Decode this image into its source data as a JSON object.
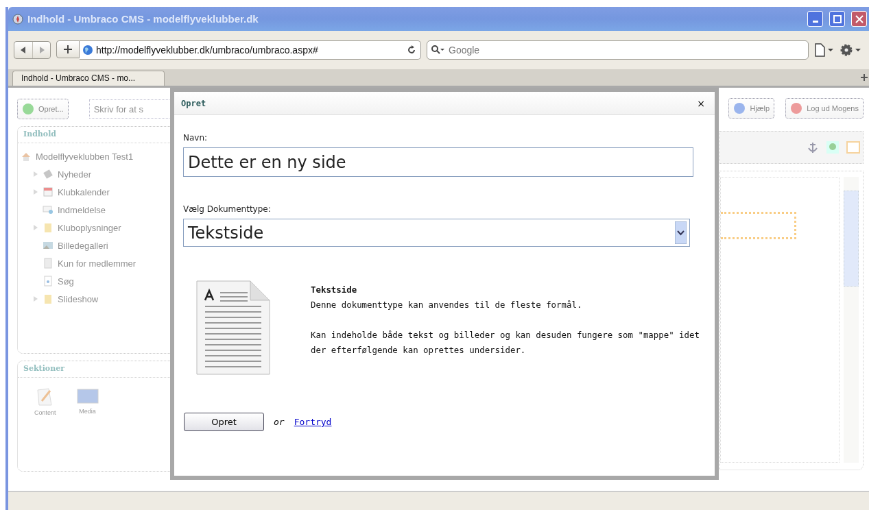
{
  "browser": {
    "title": "Indhold - Umbraco CMS - modelflyveklubber.dk",
    "url": "http://modelflyveklubber.dk/umbraco/umbraco.aspx#",
    "search_placeholder": "Google",
    "tab_label": "Indhold - Umbraco CMS - mo..."
  },
  "toolbar": {
    "create_button": "Opret...",
    "search_placeholder": "Skriv for at s",
    "help_button": "Hjælp",
    "logout_button": "Log ud Mogens"
  },
  "content_panel": {
    "title": "Indhold",
    "tree": [
      {
        "label": "Modelflyveklubben Test1",
        "kind": "home",
        "children": [
          {
            "label": "Nyheder",
            "kind": "news",
            "has_children": true
          },
          {
            "label": "Klubkalender",
            "kind": "calendar",
            "has_children": true
          },
          {
            "label": "Indmeldelse",
            "kind": "form",
            "has_children": false
          },
          {
            "label": "Kluboplysninger",
            "kind": "folder",
            "has_children": true
          },
          {
            "label": "Billedegalleri",
            "kind": "gallery",
            "has_children": false
          },
          {
            "label": "Kun for medlemmer",
            "kind": "page",
            "has_children": false
          },
          {
            "label": "Søg",
            "kind": "search",
            "has_children": false
          },
          {
            "label": "Slideshow",
            "kind": "folder",
            "has_children": true
          }
        ]
      }
    ]
  },
  "sections_panel": {
    "title": "Sektioner",
    "items": [
      {
        "label": "Content",
        "kind": "content"
      },
      {
        "label": "Media",
        "kind": "media"
      }
    ]
  },
  "dialog": {
    "title": "Opret",
    "close": "×",
    "name_label": "Navn:",
    "name_value": "Dette er en ny side",
    "type_label": "Vælg Dokumenttype:",
    "type_value": "Tekstside",
    "type_title": "Tekstside",
    "description": [
      "Denne dokumenttype kan anvendes til de fleste formål.",
      "Kan indeholde både tekst og billeder og kan desuden fungere som \"mappe\" idet der efterfølgende kan oprettes undersider."
    ],
    "submit": "Opret",
    "or": "or",
    "cancel": "Fortryd"
  }
}
